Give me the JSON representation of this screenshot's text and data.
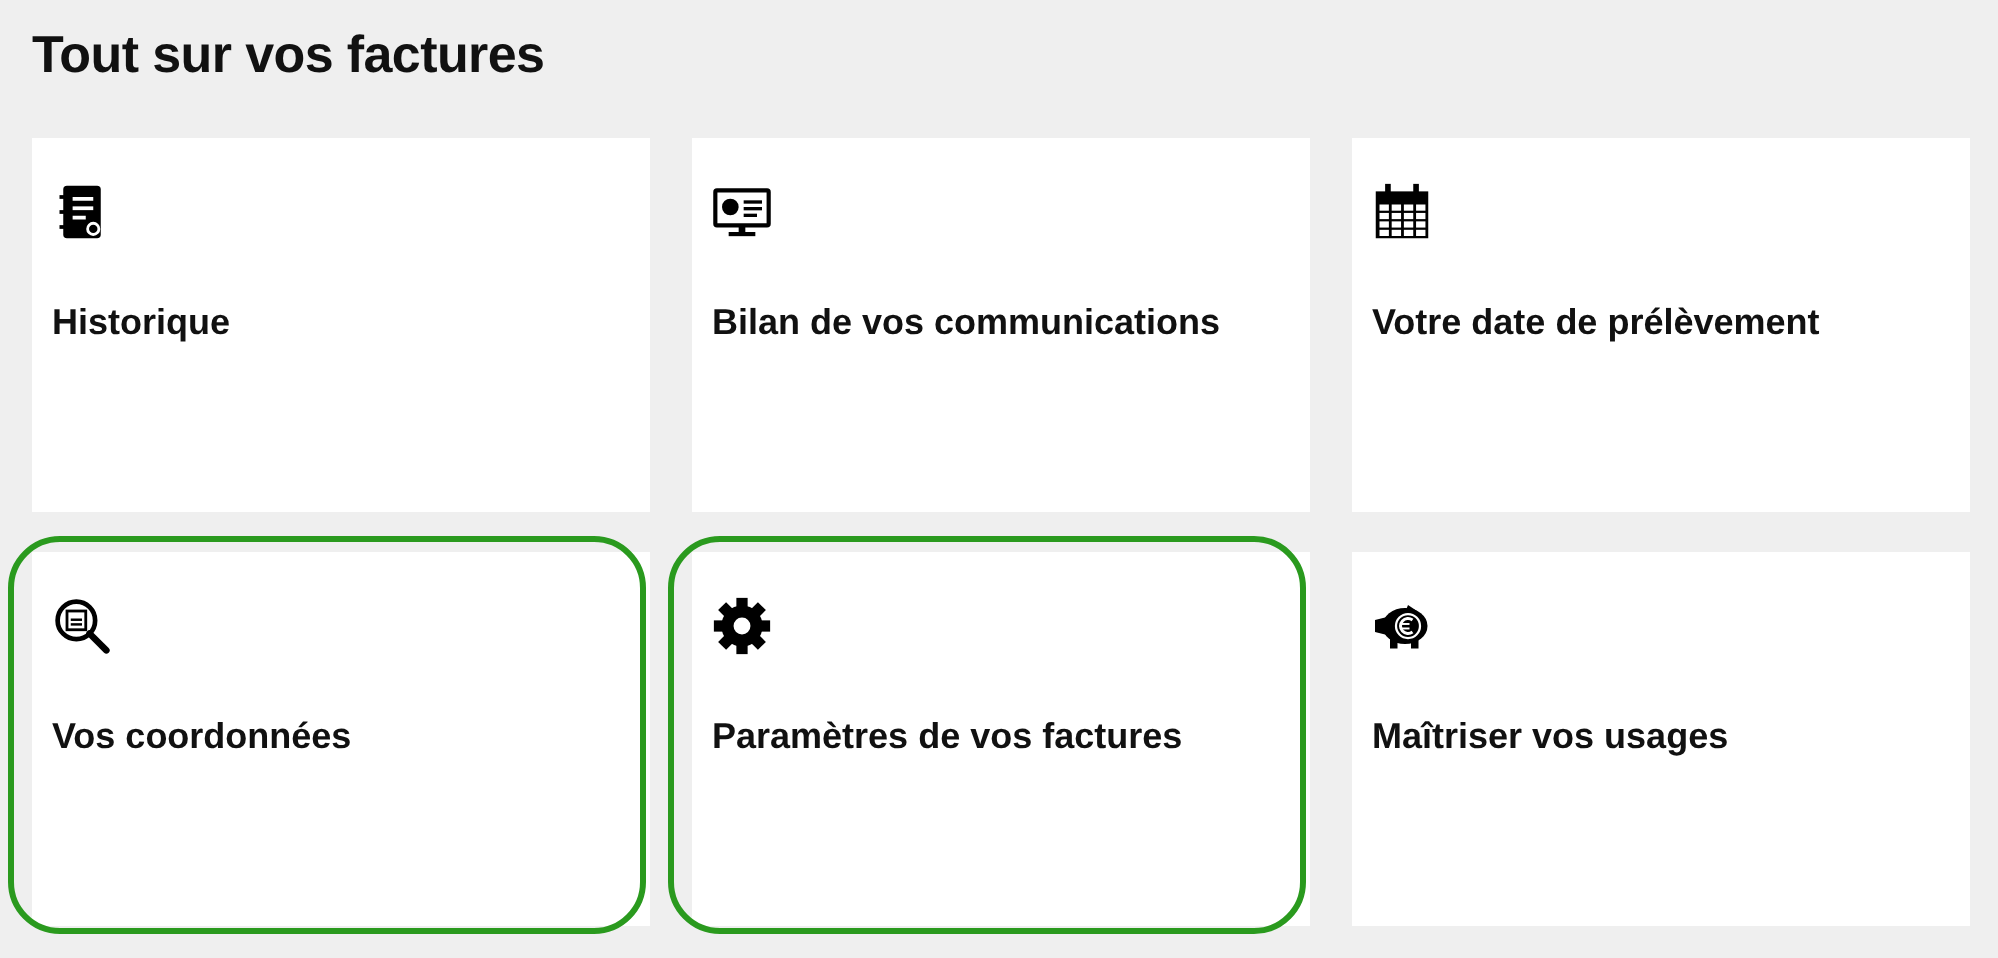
{
  "title": "Tout sur vos factures",
  "cards": [
    {
      "label": "Historique",
      "highlighted": false
    },
    {
      "label": "Bilan de vos communications",
      "highlighted": false
    },
    {
      "label": "Votre date de prélèvement",
      "highlighted": false
    },
    {
      "label": "Vos coordonnées",
      "highlighted": true
    },
    {
      "label": "Paramètres de vos factures",
      "highlighted": true
    },
    {
      "label": "Maîtriser vos usages",
      "highlighted": false
    }
  ]
}
